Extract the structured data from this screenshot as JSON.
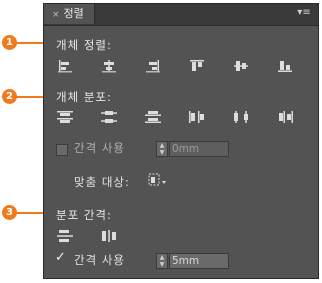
{
  "panel": {
    "tab_title": "정렬",
    "close_glyph": "×",
    "menu_glyph": "▾≡"
  },
  "sections": {
    "align_objects": {
      "label": "개체 정렬:",
      "callout": "1"
    },
    "distribute_objects": {
      "label": "개체 분포:",
      "callout": "2"
    },
    "distribute_spacing": {
      "label": "분포 간격:",
      "callout": "3"
    }
  },
  "use_spacing_top": {
    "label": "간격 사용",
    "value": "0mm",
    "checked": false
  },
  "align_to": {
    "label": "맞춤 대상:"
  },
  "use_spacing_bottom": {
    "label": "간격 사용",
    "value": "5mm",
    "checked": true,
    "check_glyph": "✓"
  },
  "colors": {
    "callout": "#f07b1f",
    "panel_bg": "#535353",
    "titlebar_bg": "#3a3a3a"
  }
}
